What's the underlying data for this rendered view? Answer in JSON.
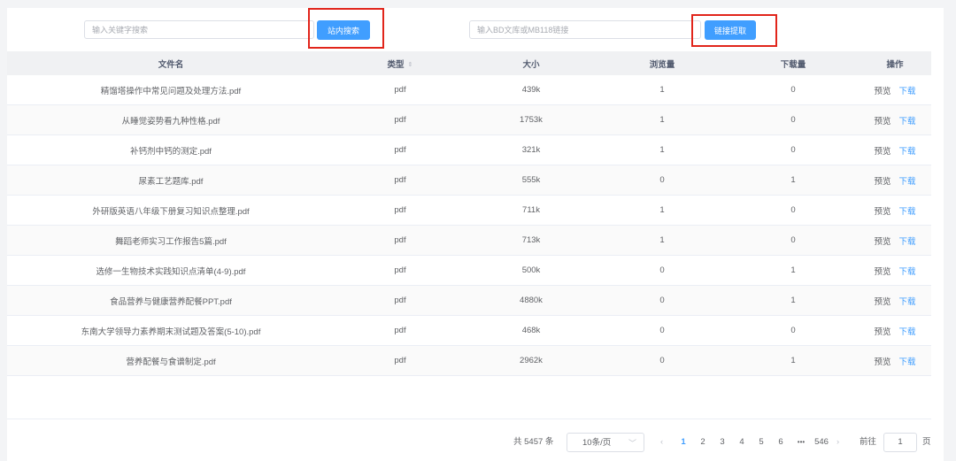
{
  "search": {
    "keyword_placeholder": "输入关键字搜索",
    "search_label": "站内搜索",
    "url_placeholder": "输入BD文库或MB118链接",
    "extract_label": "链接提取"
  },
  "table": {
    "headers": {
      "name": "文件名",
      "type": "类型",
      "size": "大小",
      "views": "浏览量",
      "downloads": "下载量",
      "actions": "操作"
    },
    "preview_label": "预览",
    "download_label": "下载",
    "rows": [
      {
        "name": "精馏塔操作中常见问题及处理方法.pdf",
        "type": "pdf",
        "size": "439k",
        "views": "1",
        "downloads": "0"
      },
      {
        "name": "从睡觉姿势看九种性格.pdf",
        "type": "pdf",
        "size": "1753k",
        "views": "1",
        "downloads": "0"
      },
      {
        "name": "补钙剂中钙的测定.pdf",
        "type": "pdf",
        "size": "321k",
        "views": "1",
        "downloads": "0"
      },
      {
        "name": "尿素工艺题库.pdf",
        "type": "pdf",
        "size": "555k",
        "views": "0",
        "downloads": "1"
      },
      {
        "name": "外研版英语八年级下册复习知识点整理.pdf",
        "type": "pdf",
        "size": "711k",
        "views": "1",
        "downloads": "0"
      },
      {
        "name": "舞蹈老师实习工作报告5篇.pdf",
        "type": "pdf",
        "size": "713k",
        "views": "1",
        "downloads": "0"
      },
      {
        "name": "选修一生物技术实践知识点清单(4-9).pdf",
        "type": "pdf",
        "size": "500k",
        "views": "0",
        "downloads": "1"
      },
      {
        "name": "食品营养与健康营养配餐PPT.pdf",
        "type": "pdf",
        "size": "4880k",
        "views": "0",
        "downloads": "1"
      },
      {
        "name": "东南大学领导力素养期末测试题及答案(5-10).pdf",
        "type": "pdf",
        "size": "468k",
        "views": "0",
        "downloads": "0"
      },
      {
        "name": "营养配餐与食谱制定.pdf",
        "type": "pdf",
        "size": "2962k",
        "views": "0",
        "downloads": "1"
      }
    ]
  },
  "pagination": {
    "total_text": "共 5457 条",
    "page_size": "10条/页",
    "pages": [
      "1",
      "2",
      "3",
      "4",
      "5",
      "6"
    ],
    "more": "•••",
    "last_page": "546",
    "active_page": "1",
    "goto_label": "前往",
    "goto_value": "1",
    "goto_unit": "页"
  },
  "colors": {
    "primary": "#409eff",
    "highlight": "#e1251b"
  }
}
